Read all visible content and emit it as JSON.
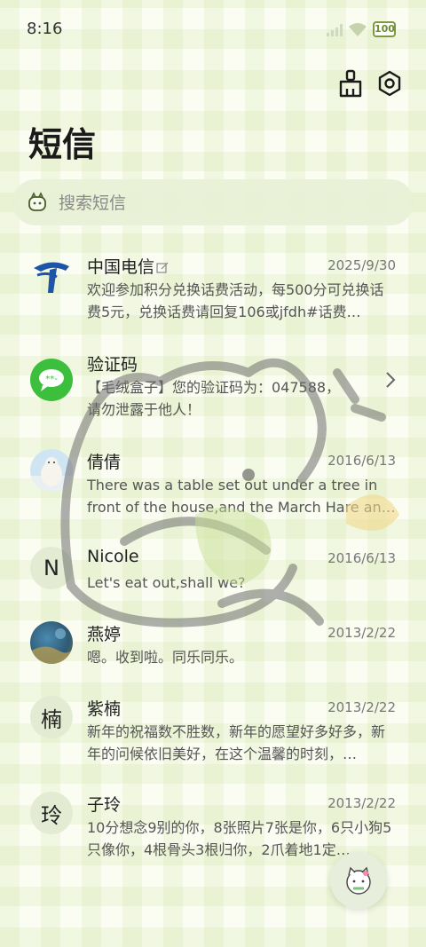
{
  "status": {
    "time": "8:16",
    "battery": "100"
  },
  "header": {
    "title": "短信"
  },
  "search": {
    "placeholder": "搜索短信"
  },
  "conversations": [
    {
      "name": "中国电信",
      "date": "2025/9/30",
      "snippet": "欢迎参加积分兑换话费活动，每500分可兑换话费5元，兑换话费请回复106或jfdh#话费…"
    },
    {
      "name": "验证码",
      "date": "",
      "snippet": "【毛绒盒子】您的验证码为：047588，请勿泄露于他人！"
    },
    {
      "name": "倩倩",
      "date": "2016/6/13",
      "snippet": "There was a table set out under a tree in front of the house,and the March Hare an…"
    },
    {
      "name": "Nicole",
      "date": "2016/6/13",
      "avatar_letter": "N",
      "snippet": "Let's eat out,shall we?"
    },
    {
      "name": "燕婷",
      "date": "2013/2/22",
      "snippet": "嗯。收到啦。同乐同乐。"
    },
    {
      "name": "紫楠",
      "date": "2013/2/22",
      "avatar_letter": "楠",
      "snippet": "新年的祝福数不胜数，新年的愿望好多好多，新年的问候依旧美好，在这个温馨的时刻，…"
    },
    {
      "name": "子玲",
      "date": "2013/2/22",
      "avatar_letter": "玲",
      "snippet": "10分想念9别的你，8张照片7张是你，6只小狗5只像你，4根骨头3根归你，2爪着地1定…"
    }
  ],
  "icons": {
    "status": [
      "signal-icon",
      "wifi-icon",
      "battery-icon"
    ],
    "header": [
      "clean-icon",
      "settings-icon"
    ],
    "search": "search-icon",
    "compose": "compose-icon"
  },
  "colors": {
    "accent": "#7c9a3e",
    "telecom_blue": "#1d54a8",
    "message_green": "#3cbf3c"
  }
}
